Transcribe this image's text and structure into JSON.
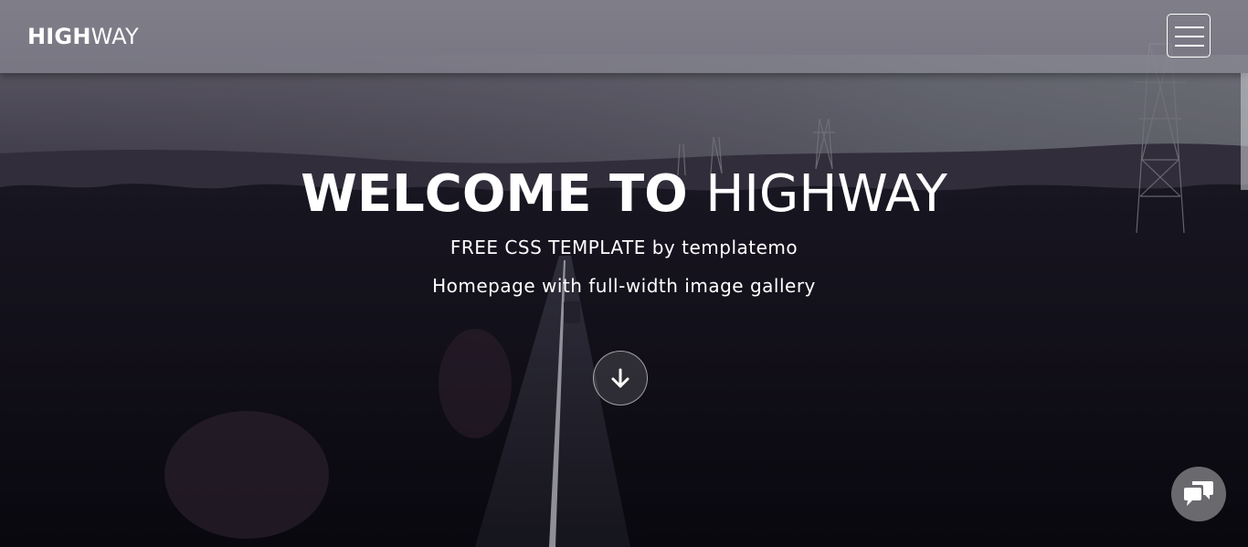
{
  "header": {
    "brand_bold": "HIGH",
    "brand_light": "WAY",
    "menu_icon": "hamburger-menu-icon"
  },
  "hero": {
    "title_bold": "WELCOME TO",
    "title_light": "HIGHWAY",
    "subtitle": "FREE CSS TEMPLATE by templatemo",
    "tagline": "Homepage with full-width image gallery",
    "scroll_icon": "arrow-down-icon"
  },
  "chat": {
    "icon": "chat-bubbles-icon"
  },
  "colors": {
    "header_overlay": "#9696a0",
    "text": "#ffffff",
    "chat_button": "#6a6a6e"
  }
}
